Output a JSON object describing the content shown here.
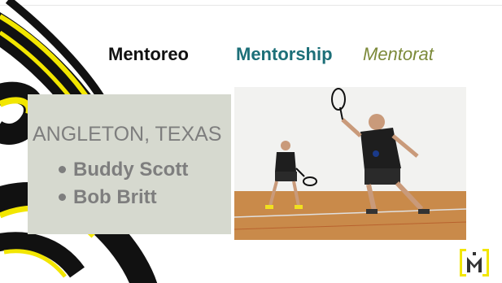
{
  "titles": {
    "spanish": "Mentoreo",
    "english": "Mentorship",
    "french": "Mentorat"
  },
  "location": "ANGLETON, TEXAS",
  "mentors": [
    {
      "name": "Buddy Scott"
    },
    {
      "name": "Bob Britt"
    }
  ],
  "colors": {
    "title_english": "#1c6f78",
    "title_french": "#7c8a3a",
    "swirl_black": "#111111",
    "swirl_yellow": "#f2e600",
    "panel": "#d6d9cf",
    "court_floor": "#c98a4a"
  }
}
